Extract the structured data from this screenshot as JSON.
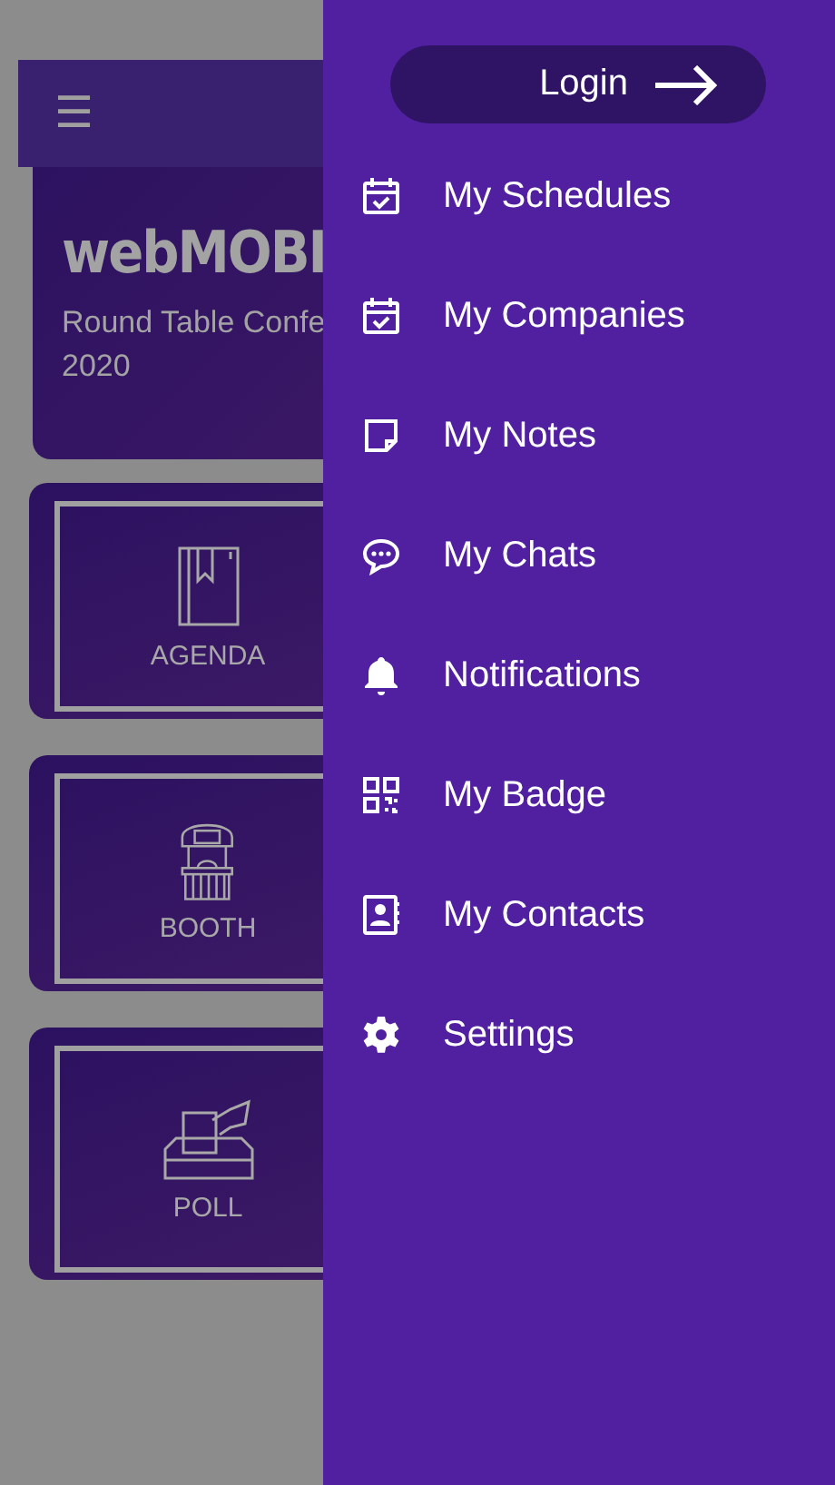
{
  "background_screen": {
    "header": {
      "menu_icon": "☰"
    },
    "event_card": {
      "title": "webMOBI",
      "subtitle": "Round Table Confe",
      "year": "2020"
    },
    "tiles": [
      {
        "kind": "agenda",
        "label": "AGENDA"
      },
      {
        "kind": "booth",
        "label": "BOOTH"
      },
      {
        "kind": "poll",
        "label": "POLL"
      }
    ]
  },
  "drawer": {
    "login_button": {
      "label": "Login"
    },
    "items": [
      {
        "kind": "calendar",
        "label": "My Schedules"
      },
      {
        "kind": "calendar",
        "label": "My Companies"
      },
      {
        "kind": "note",
        "label": "My Notes"
      },
      {
        "kind": "chat",
        "label": "My Chats"
      },
      {
        "kind": "bell",
        "label": "Notifications"
      },
      {
        "kind": "qr",
        "label": "My Badge"
      },
      {
        "kind": "contact",
        "label": "My Contacts"
      },
      {
        "kind": "gear",
        "label": "Settings"
      }
    ]
  }
}
